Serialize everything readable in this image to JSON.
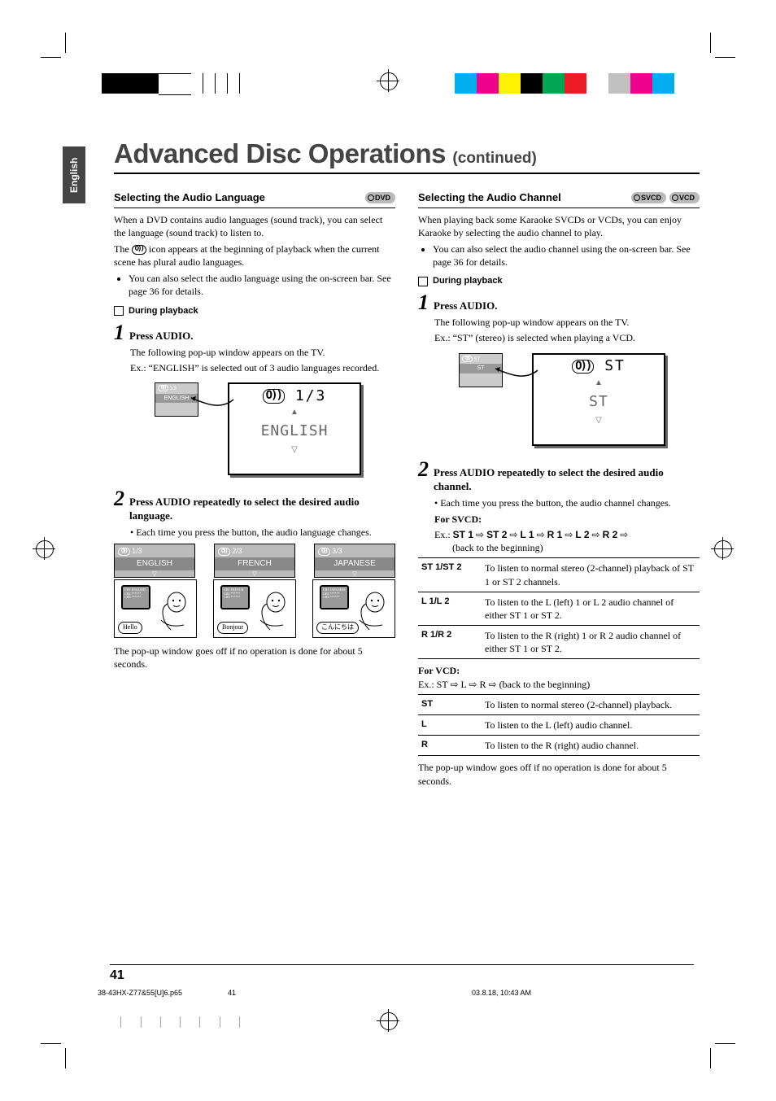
{
  "side_tab": "English",
  "title_main": "Advanced Disc Operations",
  "title_cont": "(continued)",
  "left": {
    "header": "Selecting the Audio Language",
    "pill": "DVD",
    "p1": "When a DVD contains audio languages (sound track), you can select the language (sound track) to listen to.",
    "p2a": "The ",
    "p2_glyph": "O))",
    "p2b": " icon appears at the beginning of playback when the current scene has plural audio languages.",
    "bullet1": "You can also select the audio language using the on-screen bar. See page 36 for details.",
    "during": "During playback",
    "step1": "1",
    "step1_text": "Press AUDIO.",
    "step1_sub1": "The following pop-up window appears on the TV.",
    "step1_sub2": "Ex.:   “ENGLISH” is selected out of 3 audio languages recorded.",
    "mockup1": {
      "small_count": "1/3",
      "small_lang": "ENGLISH",
      "big_count": "1/3",
      "big_lang": "ENGLISH"
    },
    "step2": "2",
    "step2_text": "Press AUDIO repeatedly to select the desired audio language.",
    "step2_bullet": "Each time you press the button, the audio language changes.",
    "popups": [
      {
        "count": "1/3",
        "lang": "ENGLISH",
        "word": "Hello"
      },
      {
        "count": "2/3",
        "lang": "FRENCH",
        "word": "Bonjour"
      },
      {
        "count": "3/3",
        "lang": "JAPANESE",
        "word": "こんにちは"
      }
    ],
    "closing": "The pop-up window goes off if no operation is done for about 5 seconds."
  },
  "right": {
    "header": "Selecting the Audio Channel",
    "pill1": "SVCD",
    "pill2": "VCD",
    "p1": "When playing back some Karaoke SVCDs or VCDs, you can enjoy Karaoke by selecting the audio channel to play.",
    "bullet1": "You can also select the audio channel using the on-screen bar. See page 36 for details.",
    "during": "During playback",
    "step1": "1",
    "step1_text": "Press AUDIO.",
    "step1_sub1": "The following pop-up window appears on the TV.",
    "step1_sub2": "Ex.:   “ST” (stereo) is selected when playing a VCD.",
    "mockup1": {
      "small_top": "ST",
      "small_mid": "ST",
      "big_top": "ST",
      "big_mid": "ST"
    },
    "step2": "2",
    "step2_text": "Press AUDIO repeatedly to select the desired audio channel.",
    "step2_bullet": "Each time you press the button, the audio channel changes.",
    "svcd_label": "For SVCD:",
    "svcd_ex_prefix": "Ex.:   ",
    "svcd_seq": [
      "ST 1",
      "ST 2",
      "L 1",
      "R 1",
      "L 2",
      "R 2"
    ],
    "svcd_back": "(back to the beginning)",
    "svcd_table": [
      {
        "k": "ST 1/ST 2",
        "v": "To listen to normal stereo (2-channel) playback of ST 1 or ST 2 channels."
      },
      {
        "k": "L 1/L 2",
        "v": "To listen to the L (left) 1 or L 2 audio channel of either ST 1 or ST 2."
      },
      {
        "k": "R 1/R 2",
        "v": "To listen to the R (right) 1 or R 2 audio channel of either ST 1 or ST 2."
      }
    ],
    "vcd_label": "For VCD:",
    "vcd_ex_prefix": "Ex.:   ",
    "vcd_seq": [
      "ST",
      "L",
      "R"
    ],
    "vcd_back": " (back to the beginning)",
    "vcd_table": [
      {
        "k": "ST",
        "v": "To listen to normal stereo (2-channel) playback."
      },
      {
        "k": "L",
        "v": "To listen to the L (left) audio channel."
      },
      {
        "k": "R",
        "v": "To listen to the R (right) audio channel."
      }
    ],
    "closing": "The pop-up window goes off if no operation is done for about 5 seconds."
  },
  "page_num": "41",
  "footer": {
    "file": "38-43HX-Z77&55[U]6.p65",
    "page": "41",
    "date": "03.8.18, 10:43 AM"
  },
  "colorbar": [
    "#00aeef",
    "#ec008c",
    "#fff200",
    "#000000",
    "#00a651",
    "#ed1c24",
    "#fff",
    "#c0c0c0",
    "#ec008c",
    "#00aeef"
  ]
}
